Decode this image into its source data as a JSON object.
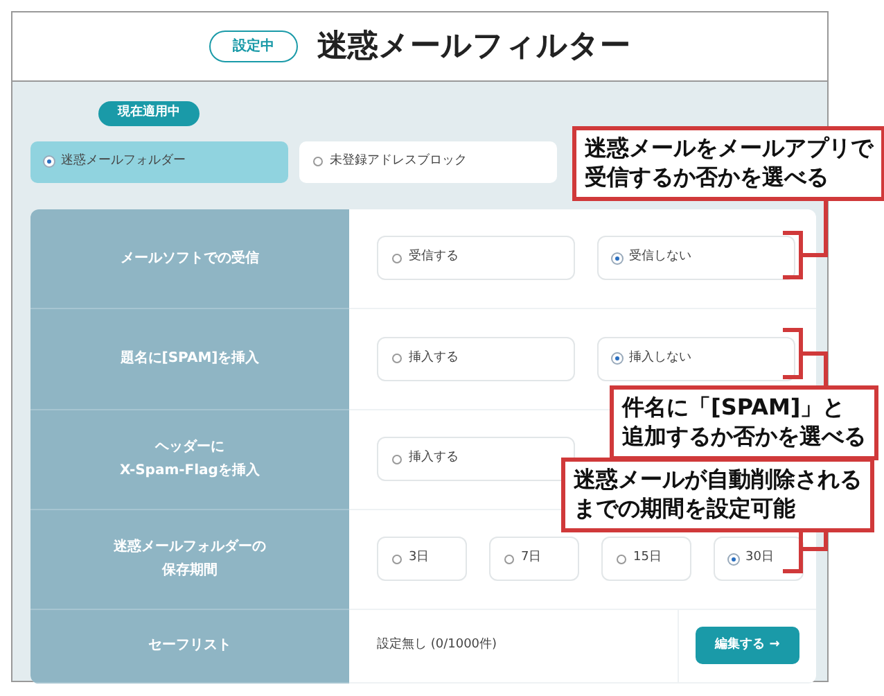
{
  "header": {
    "status_badge": "設定中",
    "title": "迷惑メールフィルター"
  },
  "current_badge": "現在適用中",
  "modes": [
    {
      "label": "迷惑メールフォルダー",
      "selected": true
    },
    {
      "label": "未登録アドレスブロック",
      "selected": false
    }
  ],
  "settings": [
    {
      "kind": "radio",
      "label_lines": [
        "メールソフトでの受信"
      ],
      "options": [
        {
          "label": "受信する",
          "selected": false
        },
        {
          "label": "受信しない",
          "selected": true
        }
      ]
    },
    {
      "kind": "radio",
      "label_lines": [
        "題名に[SPAM]を挿入"
      ],
      "options": [
        {
          "label": "挿入する",
          "selected": false
        },
        {
          "label": "挿入しない",
          "selected": true
        }
      ]
    },
    {
      "kind": "radio",
      "label_lines": [
        "ヘッダーに",
        "X-Spam-Flagを挿入"
      ],
      "options": [
        {
          "label": "挿入する",
          "selected": false
        }
      ]
    },
    {
      "kind": "radio",
      "label_lines": [
        "迷惑メールフォルダーの",
        "保存期間"
      ],
      "options": [
        {
          "label": "3日",
          "selected": false
        },
        {
          "label": "7日",
          "selected": false
        },
        {
          "label": "15日",
          "selected": false
        },
        {
          "label": "30日",
          "selected": true
        }
      ]
    },
    {
      "kind": "link",
      "label_lines": [
        "セーフリスト"
      ],
      "value": "設定無し (0/1000件)",
      "button": "編集する →"
    }
  ],
  "callouts": [
    {
      "lines": [
        "迷惑メールをメールアプリで",
        "受信するか否かを選べる"
      ]
    },
    {
      "lines": [
        "件名に「[SPAM]」と",
        "追加するか否かを選べる"
      ]
    },
    {
      "lines": [
        "迷惑メールが自動削除される",
        "までの期間を設定可能"
      ]
    }
  ]
}
